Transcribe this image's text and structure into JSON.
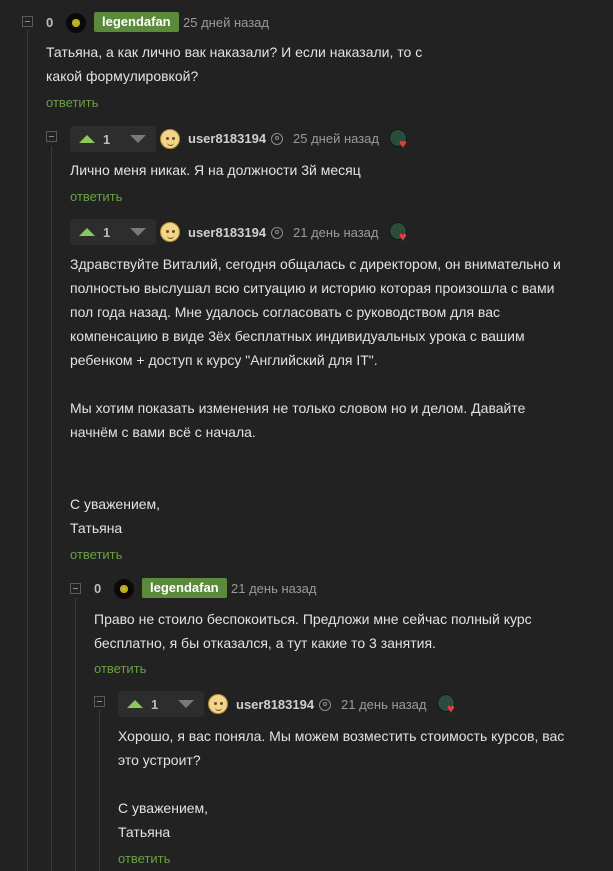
{
  "comments": [
    {
      "rating": "0",
      "user": "legendafan",
      "time": "25 дней назад",
      "text": "Татьяна, а как лично вак наказали? И если наказали, то с\nкакой формулировкой?",
      "reply": "ответить"
    },
    {
      "rating": "1",
      "user": "user8183194",
      "time": "25 дней назад",
      "text": "Лично меня никак. Я на должности 3й месяц",
      "reply": "ответить"
    },
    {
      "rating": "1",
      "user": "user8183194",
      "time": "21 день назад",
      "text": "Здравствуйте Виталий, сегодня общалась с директором, он внимательно и\nполностью выслушал всю ситуацию и историю которая произошла с вами\nпол года назад. Мне удалось согласовать с руководством для вас\nкомпенсацию в виде 3ёх бесплатных индивидуальных урока с вашим\nребенком + доступ к курсу \"Английский для IT\".\n\nМы хотим показать изменения не только словом но и делом. Давайте\nначнём с вами всё с начала.\n\n\nС уважением,\nТатьяна",
      "reply": "ответить"
    },
    {
      "rating": "0",
      "user": "legendafan",
      "time": "21 день назад",
      "text": "Право не стоило беспокоиться. Предложи мне сейчас полный курс\nбесплатно, я бы отказался, а тут какие то 3 занятия.",
      "reply": "ответить"
    },
    {
      "rating": "1",
      "user": "user8183194",
      "time": "21 день назад",
      "text": "Хорошо, я вас поняла. Мы можем возместить стоимость курсов, вас\nэто устроит?\n\nС уважением,\nТатьяна",
      "reply": "ответить"
    }
  ]
}
